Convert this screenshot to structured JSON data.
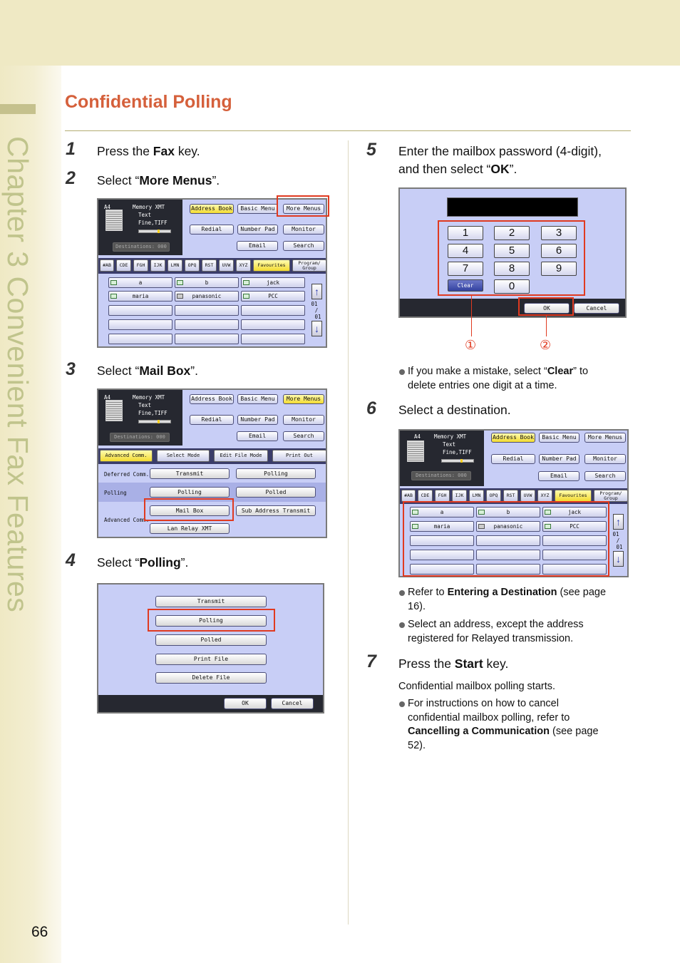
{
  "chapter_label": "Chapter 3   Convenient Fax Features",
  "page_number": "66",
  "section_title": "Confidential Polling",
  "steps": [
    {
      "num": "1",
      "pre": "Press the ",
      "bold": "Fax",
      "post": " key."
    },
    {
      "num": "2",
      "pre": "Select “",
      "bold": "More Menus",
      "post": "”."
    },
    {
      "num": "3",
      "pre": "Select “",
      "bold": "Mail Box",
      "post": "”."
    },
    {
      "num": "4",
      "pre": "Select “",
      "bold": "Polling",
      "post": "”."
    },
    {
      "num": "5",
      "line1": "Enter the mailbox password (4-digit),",
      "line2_pre": "and then select “",
      "bold": "OK",
      "line2_post": "”."
    },
    {
      "num": "6",
      "text": "Select a destination."
    },
    {
      "num": "7",
      "pre": "Press the ",
      "bold": "Start",
      "post": " key."
    }
  ],
  "step5_notes": {
    "line1_pre": "If you make a mistake, select “",
    "line1_bold": "Clear",
    "line1_post": "” to",
    "line2": "delete entries one digit at a time."
  },
  "step6_notes": [
    {
      "l1_pre": "Refer to ",
      "l1_bold": "Entering a Destination",
      "l1_post": " (see page",
      "l2": "16)."
    },
    {
      "l1": "Select an address, except the address",
      "l2": "registered for Relayed transmission."
    }
  ],
  "step7_notes": {
    "intro": "Confidential mailbox polling starts.",
    "l1": "For instructions on how to cancel",
    "l2": "confidential mailbox polling, refer to",
    "l3_bold": "Cancelling a Communication",
    "l3_post": " (see page",
    "l4": "52)."
  },
  "fax_screen": {
    "mode": "A4",
    "memory_xmt": "Memory XMT",
    "text_mode": "Text",
    "resolution": "Fine,TIFF",
    "destinations": "Destinations: 000",
    "top_buttons": [
      "Address Book",
      "Basic Menu",
      "More Menus"
    ],
    "mid_buttons": [
      "Redial",
      "Number Pad",
      "Monitor"
    ],
    "email": "Email",
    "search": "Search",
    "tabs": [
      "#AB",
      "CDE",
      "FGH",
      "IJK",
      "LMN",
      "OPQ",
      "RST",
      "UVW",
      "XYZ",
      "Favourites",
      "Program/ Group"
    ],
    "entries": [
      [
        "a",
        "b",
        "jack"
      ],
      [
        "maria",
        "panasonic",
        "PCC"
      ]
    ],
    "page_top": "01",
    "page_sep": "/",
    "page_bot": "01",
    "up_arrow": "↑",
    "down_arrow": "↓"
  },
  "more_menus": {
    "tabs": [
      "Advanced Comm.",
      "Select Mode",
      "Edit File Mode",
      "Print Out"
    ],
    "rows": [
      {
        "label": "Deferred Comm.",
        "btns": [
          "Transmit",
          "Polling"
        ]
      },
      {
        "label": "Polling",
        "btns": [
          "Polling",
          "Polled"
        ]
      },
      {
        "label": "Advanced Comm.",
        "btns": [
          "Mail Box",
          "Sub Address Transmit",
          "Lan Relay XMT"
        ]
      }
    ]
  },
  "mailbox_menu": {
    "items": [
      "Transmit",
      "Polling",
      "Polled",
      "Print File",
      "Delete File"
    ],
    "ok": "OK",
    "cancel": "Cancel"
  },
  "keypad": {
    "keys": [
      "1",
      "2",
      "3",
      "4",
      "5",
      "6",
      "7",
      "8",
      "9",
      "Clear",
      "0"
    ],
    "ok": "OK",
    "cancel": "Cancel",
    "callouts": [
      "①",
      "②"
    ]
  }
}
